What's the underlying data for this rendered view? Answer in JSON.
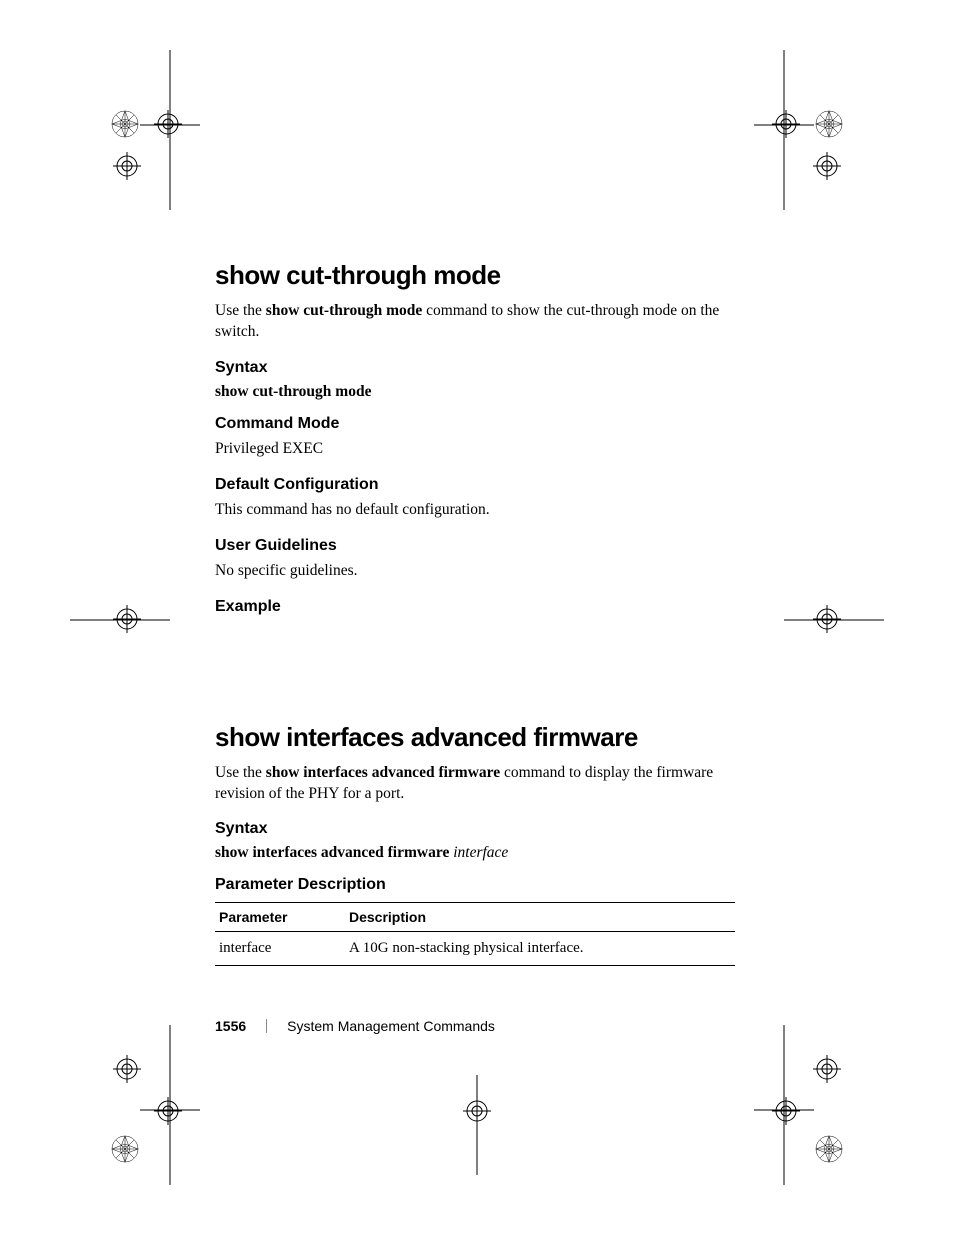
{
  "section1": {
    "title": "show cut-through mode",
    "intro_prefix": "Use the ",
    "intro_cmd": "show cut-through mode",
    "intro_suffix": " command to show the cut-through mode on the switch.",
    "syntax_h": "Syntax",
    "syntax_body": "show cut-through mode",
    "cmdmode_h": "Command Mode",
    "cmdmode_body": "Privileged EXEC",
    "defcfg_h": "Default Configuration",
    "defcfg_body": "This command has no default configuration.",
    "userg_h": "User Guidelines",
    "userg_body": "No specific guidelines.",
    "example_h": "Example"
  },
  "section2": {
    "title": "show interfaces advanced firmware",
    "intro_prefix": "Use the ",
    "intro_cmd": "show interfaces advanced firmware",
    "intro_suffix": " command to display the firmware revision of the PHY for a port.",
    "syntax_h": "Syntax",
    "syntax_cmd": "show interfaces advanced firmware",
    "syntax_arg": "interface",
    "paramdesc_h": "Parameter Description",
    "table": {
      "col1": "Parameter",
      "col2": "Description",
      "row1_param": "interface",
      "row1_desc": "A 10G non-stacking physical interface."
    }
  },
  "footer": {
    "page": "1556",
    "section": "System Management Commands"
  }
}
